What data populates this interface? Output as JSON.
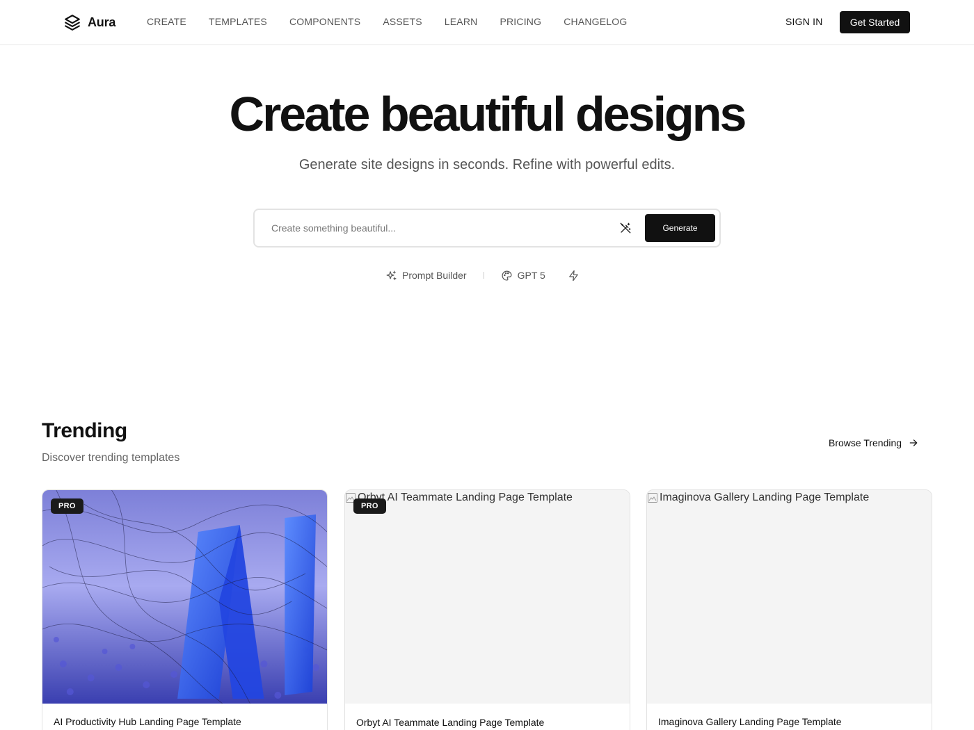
{
  "header": {
    "logo_text": "Aura",
    "nav": [
      "CREATE",
      "TEMPLATES",
      "COMPONENTS",
      "ASSETS",
      "LEARN",
      "PRICING",
      "CHANGELOG"
    ],
    "sign_in": "SIGN IN",
    "get_started": "Get Started"
  },
  "hero": {
    "title": "Create beautiful designs",
    "subtitle": "Generate site designs in seconds. Refine with powerful edits.",
    "prompt_placeholder": "Create something beautiful...",
    "generate_label": "Generate",
    "tools": {
      "prompt_builder": "Prompt Builder",
      "model": "GPT 5"
    }
  },
  "trending": {
    "title": "Trending",
    "subtitle": "Discover trending templates",
    "browse_label": "Browse Trending",
    "cards": [
      {
        "title": "AI Productivity Hub Landing Page Template",
        "badge": "PRO",
        "image_alt": ""
      },
      {
        "title": "Orbyt AI Teammate Landing Page Template",
        "badge": "PRO",
        "image_alt": "Orbyt AI Teammate Landing Page Template"
      },
      {
        "title": "Imaginova Gallery Landing Page Template",
        "badge": "",
        "image_alt": "Imaginova Gallery Landing Page Template"
      }
    ]
  },
  "colors": {
    "accent": "#111111",
    "muted_text": "#555555",
    "border": "#e3e3e3"
  }
}
